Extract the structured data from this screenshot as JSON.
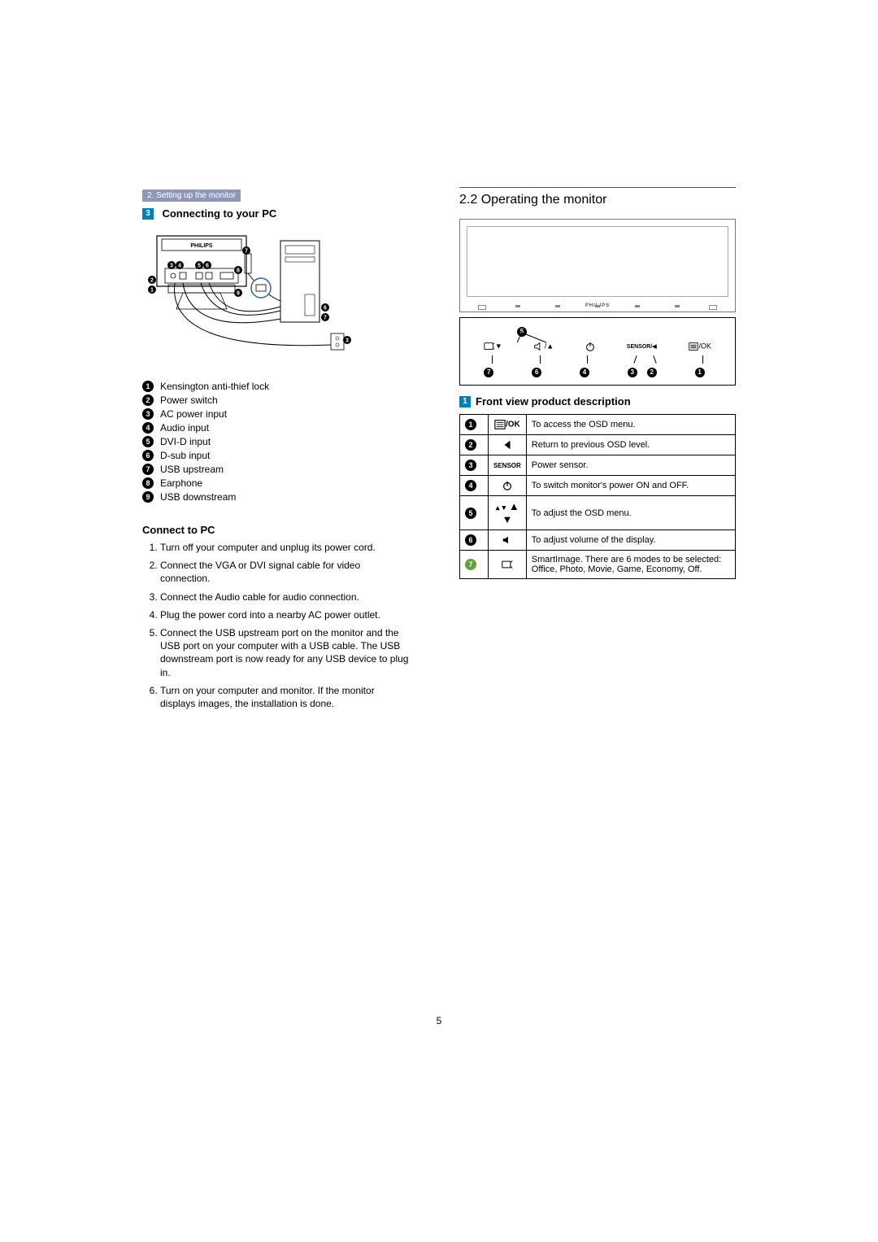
{
  "breadcrumb": "2. Setting up the monitor",
  "left": {
    "stepbox": "3",
    "heading": "Connecting to your PC",
    "brand": "PHILIPS",
    "legend": [
      "Kensington anti-thief lock",
      "Power switch",
      "AC power input",
      "Audio input",
      "DVI-D input",
      "D-sub input",
      "USB upstream",
      "Earphone",
      "USB downstream"
    ],
    "connect_heading": "Connect to PC",
    "steps": [
      "Turn off your computer and unplug its power cord.",
      "Connect the VGA or DVI signal cable for video connection.",
      "Connect the Audio cable for audio connection.",
      "Plug the power cord into a nearby AC power outlet.",
      "Connect the USB upstream port on the monitor and the USB port on your computer with a USB cable. The USB downstream port is now ready for any USB device to plug in.",
      "Turn on your computer and monitor. If the monitor displays images, the installation is done."
    ]
  },
  "right": {
    "heading": "2.2  Operating the monitor",
    "brand": "PHILIPS",
    "front_stepbox": "1",
    "front_heading": "Front view product description",
    "detail_labels": {
      "l1": "▼",
      "l2": "/▲",
      "l3": "SENSOR/◀",
      "l4": "/OK"
    },
    "table": [
      {
        "icon": "menu-ok",
        "text": "To access the OSD menu."
      },
      {
        "icon": "left",
        "text": "Return to previous OSD level."
      },
      {
        "icon": "sensor",
        "text": "Power sensor."
      },
      {
        "icon": "power",
        "text": "To switch monitor's power ON and OFF."
      },
      {
        "icon": "updown",
        "text": "To adjust the OSD menu."
      },
      {
        "icon": "vol",
        "text": "To adjust volume of the display."
      },
      {
        "icon": "smart",
        "text": "SmartImage. There are 6 modes to be selected: Office, Photo, Movie, Game, Economy, Off."
      }
    ]
  },
  "page_number": "5"
}
